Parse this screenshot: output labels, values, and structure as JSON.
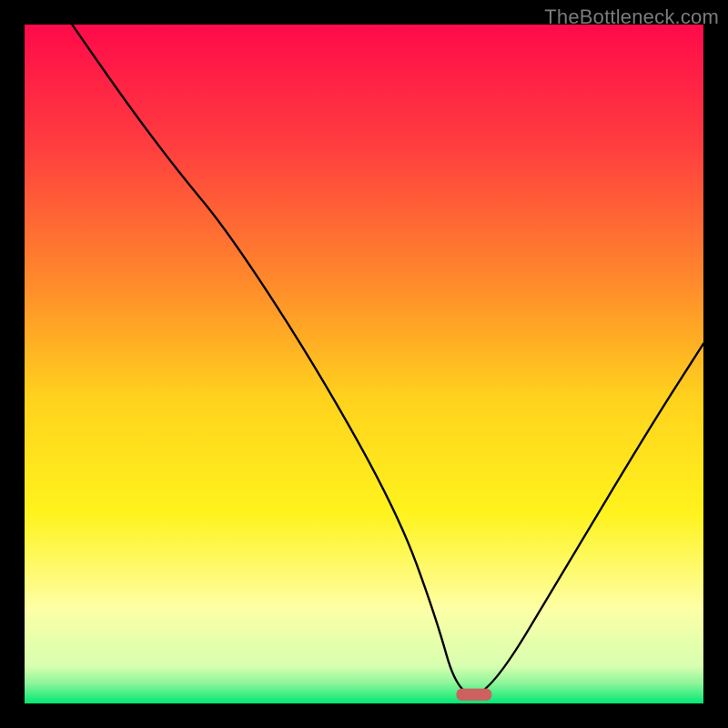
{
  "attribution": "TheBottleneck.com",
  "chart_data": {
    "type": "line",
    "title": "",
    "xlabel": "",
    "ylabel": "",
    "xlim": [
      0,
      100
    ],
    "ylim": [
      0,
      100
    ],
    "gradient_stops": [
      {
        "offset": 0.0,
        "color": "#ff0a4a"
      },
      {
        "offset": 0.18,
        "color": "#ff3e3f"
      },
      {
        "offset": 0.38,
        "color": "#ff8a2b"
      },
      {
        "offset": 0.55,
        "color": "#ffd21d"
      },
      {
        "offset": 0.72,
        "color": "#fff31d"
      },
      {
        "offset": 0.86,
        "color": "#fdffa5"
      },
      {
        "offset": 0.945,
        "color": "#d7ffb0"
      },
      {
        "offset": 0.97,
        "color": "#8ff59a"
      },
      {
        "offset": 1.0,
        "color": "#00e874"
      }
    ],
    "series": [
      {
        "name": "bottleneck-curve",
        "x": [
          7,
          15,
          22.5,
          30,
          43,
          55,
          60.5,
          63.8,
          68.5,
          80,
          92,
          100
        ],
        "y": [
          100,
          88.5,
          78.5,
          69.5,
          49.5,
          28,
          13,
          1.3,
          1.3,
          20.5,
          40.5,
          53
        ]
      }
    ],
    "marker": {
      "name": "optimal-marker",
      "x": 66.2,
      "y": 1.3,
      "width_pct": 5.2,
      "height_pct": 1.8,
      "color": "#cc615f"
    }
  }
}
